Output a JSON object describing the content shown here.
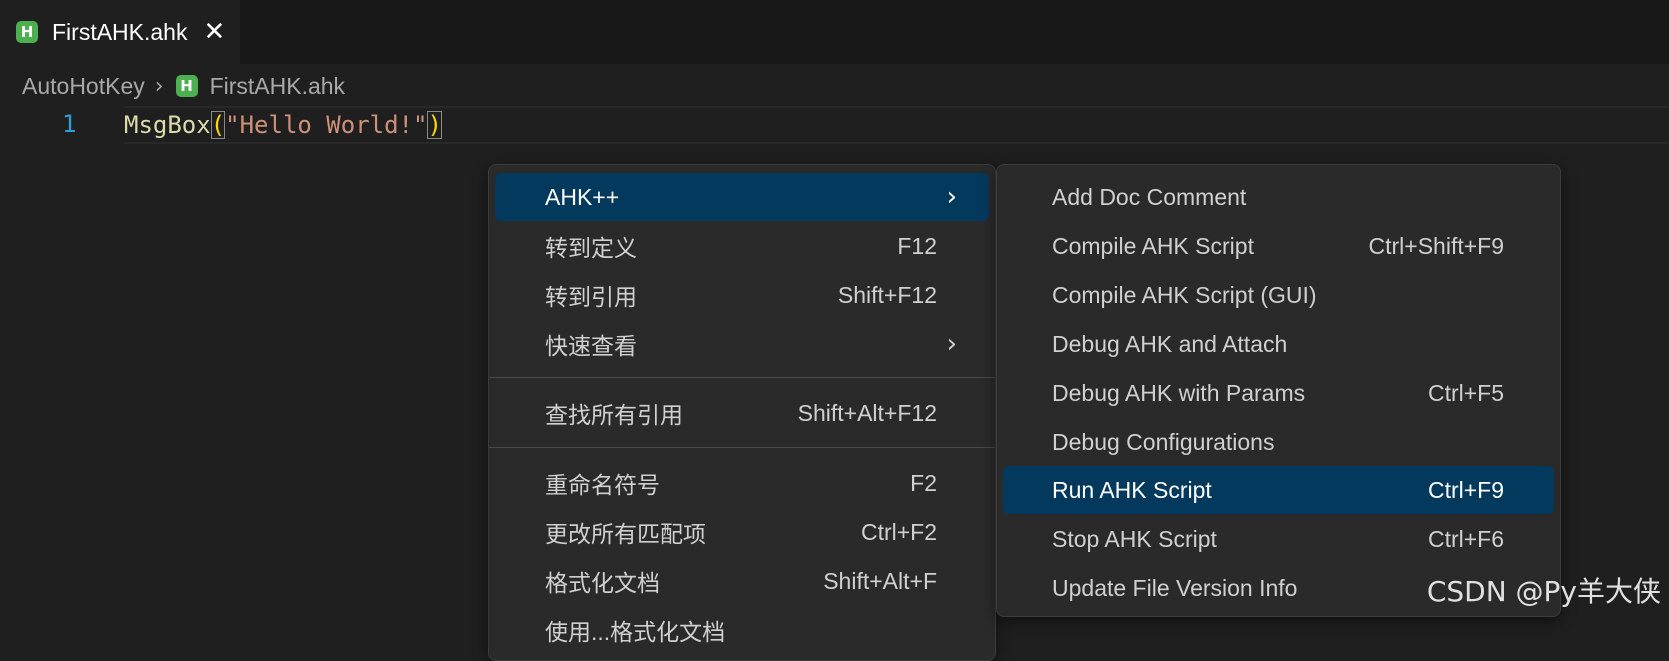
{
  "tab": {
    "icon": "ahk-file-icon",
    "icon_glyph": "H",
    "title": "FirstAHK.ahk",
    "close_glyph": "✕"
  },
  "breadcrumb": {
    "folder": "AutoHotKey",
    "separator": "›",
    "file": "FirstAHK.ahk"
  },
  "editor": {
    "line_number": "1",
    "tokens": {
      "fn": "MsgBox",
      "open": "(",
      "str": "\"Hello World!\"",
      "close": ")"
    }
  },
  "context_menu": {
    "items": [
      {
        "label": "AHK++",
        "keys": "",
        "submenu": true,
        "selected": true
      },
      {
        "label": "转到定义",
        "keys": "F12"
      },
      {
        "label": "转到引用",
        "keys": "Shift+F12"
      },
      {
        "label": "快速查看",
        "keys": "",
        "submenu": true
      },
      {
        "label": "查找所有引用",
        "keys": "Shift+Alt+F12"
      },
      {
        "label": "重命名符号",
        "keys": "F2"
      },
      {
        "label": "更改所有匹配项",
        "keys": "Ctrl+F2"
      },
      {
        "label": "格式化文档",
        "keys": "Shift+Alt+F"
      },
      {
        "label": "使用...格式化文档",
        "keys": ""
      }
    ],
    "chevron": "›"
  },
  "submenu": {
    "items": [
      {
        "label": "Add Doc Comment",
        "keys": ""
      },
      {
        "label": "Compile AHK Script",
        "keys": "Ctrl+Shift+F9"
      },
      {
        "label": "Compile AHK Script (GUI)",
        "keys": ""
      },
      {
        "label": "Debug AHK and Attach",
        "keys": ""
      },
      {
        "label": "Debug AHK with Params",
        "keys": "Ctrl+F5"
      },
      {
        "label": "Debug Configurations",
        "keys": ""
      },
      {
        "label": "Run AHK Script",
        "keys": "Ctrl+F9",
        "selected": true
      },
      {
        "label": "Stop AHK Script",
        "keys": "Ctrl+F6"
      },
      {
        "label": "Update File Version Info",
        "keys": ""
      }
    ]
  },
  "watermark": "CSDN @Py羊大侠",
  "colors": {
    "accent_selected": "#04395e",
    "ahk_icon": "#4caf50",
    "string": "#ce9178",
    "function": "#dcdcaa",
    "line_number": "#2f9fd3"
  }
}
